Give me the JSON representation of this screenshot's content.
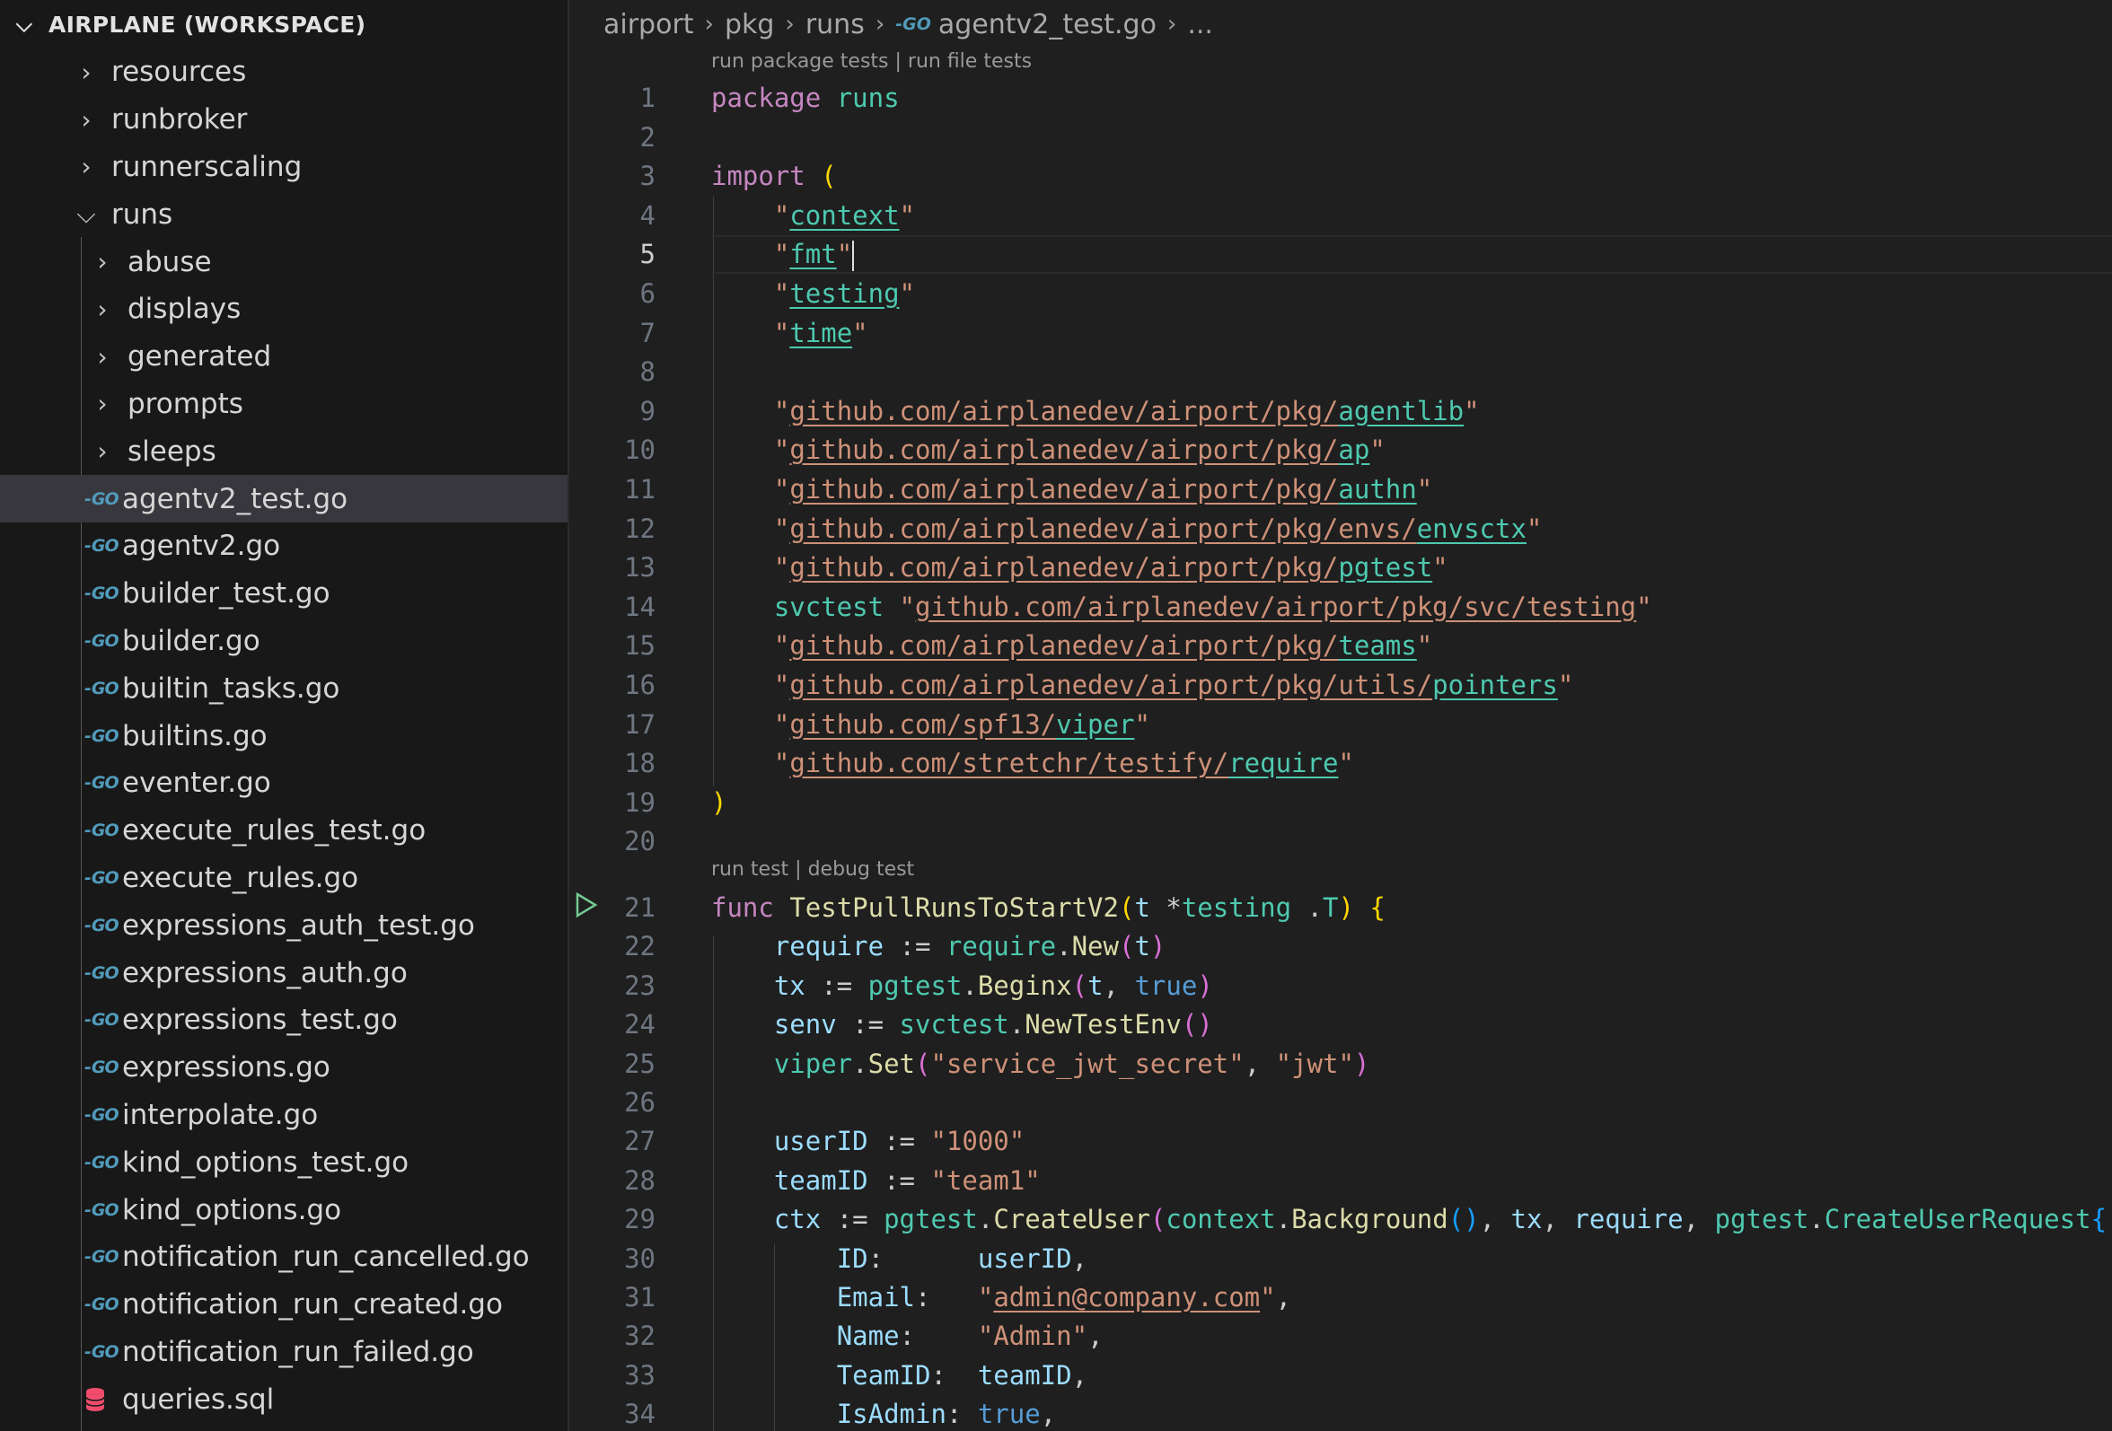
{
  "sidebar": {
    "workspace_title": "AIRPLANE (WORKSPACE)",
    "items": [
      {
        "label": "resources",
        "type": "folder",
        "expanded": false,
        "depth": 1
      },
      {
        "label": "runbroker",
        "type": "folder",
        "expanded": false,
        "depth": 1
      },
      {
        "label": "runnerscaling",
        "type": "folder",
        "expanded": false,
        "depth": 1
      },
      {
        "label": "runs",
        "type": "folder",
        "expanded": true,
        "depth": 1
      },
      {
        "label": "abuse",
        "type": "folder",
        "expanded": false,
        "depth": 2
      },
      {
        "label": "displays",
        "type": "folder",
        "expanded": false,
        "depth": 2
      },
      {
        "label": "generated",
        "type": "folder",
        "expanded": false,
        "depth": 2
      },
      {
        "label": "prompts",
        "type": "folder",
        "expanded": false,
        "depth": 2
      },
      {
        "label": "sleeps",
        "type": "folder",
        "expanded": false,
        "depth": 2
      },
      {
        "label": "agentv2_test.go",
        "type": "go",
        "selected": true,
        "depth": 2
      },
      {
        "label": "agentv2.go",
        "type": "go",
        "depth": 2
      },
      {
        "label": "builder_test.go",
        "type": "go",
        "depth": 2
      },
      {
        "label": "builder.go",
        "type": "go",
        "depth": 2
      },
      {
        "label": "builtin_tasks.go",
        "type": "go",
        "depth": 2
      },
      {
        "label": "builtins.go",
        "type": "go",
        "depth": 2
      },
      {
        "label": "eventer.go",
        "type": "go",
        "depth": 2
      },
      {
        "label": "execute_rules_test.go",
        "type": "go",
        "depth": 2
      },
      {
        "label": "execute_rules.go",
        "type": "go",
        "depth": 2
      },
      {
        "label": "expressions_auth_test.go",
        "type": "go",
        "depth": 2
      },
      {
        "label": "expressions_auth.go",
        "type": "go",
        "depth": 2
      },
      {
        "label": "expressions_test.go",
        "type": "go",
        "depth": 2
      },
      {
        "label": "expressions.go",
        "type": "go",
        "depth": 2
      },
      {
        "label": "interpolate.go",
        "type": "go",
        "depth": 2
      },
      {
        "label": "kind_options_test.go",
        "type": "go",
        "depth": 2
      },
      {
        "label": "kind_options.go",
        "type": "go",
        "depth": 2
      },
      {
        "label": "notification_run_cancelled.go",
        "type": "go",
        "depth": 2
      },
      {
        "label": "notification_run_created.go",
        "type": "go",
        "depth": 2
      },
      {
        "label": "notification_run_failed.go",
        "type": "go",
        "depth": 2
      },
      {
        "label": "queries.sql",
        "type": "sql",
        "depth": 2
      }
    ]
  },
  "breadcrumb": {
    "parts": [
      "airport",
      "pkg",
      "runs",
      "agentv2_test.go",
      "..."
    ],
    "go_icon": "GO"
  },
  "editor": {
    "codelens_top": "run package tests | run file tests",
    "codelens_func": "run test | debug test",
    "current_line": 5,
    "line_numbers": [
      "1",
      "2",
      "3",
      "4",
      "5",
      "6",
      "7",
      "8",
      "9",
      "10",
      "11",
      "12",
      "13",
      "14",
      "15",
      "16",
      "17",
      "18",
      "19",
      "20",
      "21",
      "22",
      "23",
      "24",
      "25",
      "26",
      "27",
      "28",
      "29",
      "30",
      "31",
      "32",
      "33",
      "34"
    ],
    "colors": {
      "keyword": "#c586c0",
      "type": "#4ec9b0",
      "function": "#dcdcaa",
      "variable": "#9cdcfe",
      "string": "#ce9178",
      "constant": "#569cd6"
    },
    "lines": [
      [
        [
          "k",
          "package"
        ],
        [
          "",
          "",
          " "
        ],
        [
          "t",
          "runs"
        ]
      ],
      [],
      [
        [
          "k",
          "import"
        ],
        [
          "",
          "",
          " "
        ],
        [
          "p1",
          "("
        ]
      ],
      [
        [
          "",
          "",
          " "
        ],
        [
          "s",
          "\""
        ],
        [
          "t u",
          "context"
        ],
        [
          "s",
          "\""
        ]
      ],
      [
        [
          "",
          "",
          " "
        ],
        [
          "s",
          "\""
        ],
        [
          "t u",
          "fmt"
        ],
        [
          "s",
          "\""
        ]
      ],
      [
        [
          "",
          "",
          " "
        ],
        [
          "s",
          "\""
        ],
        [
          "t u",
          "testing"
        ],
        [
          "s",
          "\""
        ]
      ],
      [
        [
          "",
          "",
          " "
        ],
        [
          "s",
          "\""
        ],
        [
          "t u",
          "time"
        ],
        [
          "s",
          "\""
        ]
      ],
      [],
      [
        [
          "",
          "",
          " "
        ],
        [
          "s",
          "\""
        ],
        [
          "s u",
          "github.com/airplanedev/airport/pkg/"
        ],
        [
          "t u",
          "agentlib"
        ],
        [
          "s",
          "\""
        ]
      ],
      [
        [
          "",
          "",
          " "
        ],
        [
          "s",
          "\""
        ],
        [
          "s u",
          "github.com/airplanedev/airport/pkg/"
        ],
        [
          "t u",
          "ap"
        ],
        [
          "s",
          "\""
        ]
      ],
      [
        [
          "",
          "",
          " "
        ],
        [
          "s",
          "\""
        ],
        [
          "s u",
          "github.com/airplanedev/airport/pkg/"
        ],
        [
          "t u",
          "authn"
        ],
        [
          "s",
          "\""
        ]
      ],
      [
        [
          "",
          "",
          " "
        ],
        [
          "s",
          "\""
        ],
        [
          "s u",
          "github.com/airplanedev/airport/pkg/envs/"
        ],
        [
          "t u",
          "envsctx"
        ],
        [
          "s",
          "\""
        ]
      ],
      [
        [
          "",
          "",
          " "
        ],
        [
          "s",
          "\""
        ],
        [
          "s u",
          "github.com/airplanedev/airport/pkg/"
        ],
        [
          "t u",
          "pgtest"
        ],
        [
          "s",
          "\""
        ]
      ],
      [
        [
          "",
          "",
          " "
        ],
        [
          "t",
          "svctest"
        ],
        [
          "",
          "",
          " "
        ],
        [
          "s",
          "\""
        ],
        [
          "s u",
          "github.com/airplanedev/airport/pkg/svc/testing"
        ],
        [
          "s",
          "\""
        ]
      ],
      [
        [
          "",
          "",
          " "
        ],
        [
          "s",
          "\""
        ],
        [
          "s u",
          "github.com/airplanedev/airport/pkg/"
        ],
        [
          "t u",
          "teams"
        ],
        [
          "s",
          "\""
        ]
      ],
      [
        [
          "",
          "",
          " "
        ],
        [
          "s",
          "\""
        ],
        [
          "s u",
          "github.com/airplanedev/airport/pkg/utils/"
        ],
        [
          "t u",
          "pointers"
        ],
        [
          "s",
          "\""
        ]
      ],
      [
        [
          "",
          "",
          " "
        ],
        [
          "s",
          "\""
        ],
        [
          "s u",
          "github.com/spf13/"
        ],
        [
          "t u",
          "viper"
        ],
        [
          "s",
          "\""
        ]
      ],
      [
        [
          "",
          "",
          " "
        ],
        [
          "s",
          "\""
        ],
        [
          "s u",
          "github.com/stretchr/testify/"
        ],
        [
          "t u",
          "require"
        ],
        [
          "s",
          "\""
        ]
      ],
      [
        [
          "p1",
          ")"
        ]
      ],
      [],
      [
        [
          "k",
          "func"
        ],
        [
          "",
          "",
          " "
        ],
        [
          "f",
          "TestPullRunsToStartV2"
        ],
        [
          "p1",
          "("
        ],
        [
          "v",
          "t"
        ],
        [
          "",
          "",
          " *"
        ],
        [
          "t",
          "testing"
        ],
        [
          "",
          "",
          " ."
        ],
        [
          "t",
          "T"
        ],
        [
          "p1",
          ")"
        ],
        [
          "",
          "",
          " "
        ],
        [
          "p1",
          "{"
        ]
      ],
      [
        [
          "",
          "",
          " "
        ],
        [
          "v",
          "require"
        ],
        [
          "",
          "",
          " := "
        ],
        [
          "t",
          "require"
        ],
        [
          "",
          "",
          "."
        ],
        [
          "f",
          "New"
        ],
        [
          "p2",
          "("
        ],
        [
          "v",
          "t"
        ],
        [
          "p2",
          ")"
        ]
      ],
      [
        [
          "",
          "",
          " "
        ],
        [
          "v",
          "tx"
        ],
        [
          "",
          "",
          " := "
        ],
        [
          "t",
          "pgtest"
        ],
        [
          "",
          "",
          "."
        ],
        [
          "f",
          "Beginx"
        ],
        [
          "p2",
          "("
        ],
        [
          "v",
          "t"
        ],
        [
          "",
          "",
          ", "
        ],
        [
          "kb",
          "true"
        ],
        [
          "p2",
          ")"
        ]
      ],
      [
        [
          "",
          "",
          " "
        ],
        [
          "v",
          "senv"
        ],
        [
          "",
          "",
          " := "
        ],
        [
          "t",
          "svctest"
        ],
        [
          "",
          "",
          "."
        ],
        [
          "f",
          "NewTestEnv"
        ],
        [
          "p2",
          "()"
        ]
      ],
      [
        [
          "",
          "",
          " "
        ],
        [
          "t",
          "viper"
        ],
        [
          "",
          "",
          "."
        ],
        [
          "f",
          "Set"
        ],
        [
          "p2",
          "("
        ],
        [
          "s",
          "\"service_jwt_secret\""
        ],
        [
          "",
          "",
          ", "
        ],
        [
          "s",
          "\"jwt\""
        ],
        [
          "p2",
          ")"
        ]
      ],
      [],
      [
        [
          "",
          "",
          " "
        ],
        [
          "v",
          "userID"
        ],
        [
          "",
          "",
          " := "
        ],
        [
          "s",
          "\"1000\""
        ]
      ],
      [
        [
          "",
          "",
          " "
        ],
        [
          "v",
          "teamID"
        ],
        [
          "",
          "",
          " := "
        ],
        [
          "s",
          "\"team1\""
        ]
      ],
      [
        [
          "",
          "",
          " "
        ],
        [
          "v",
          "ctx"
        ],
        [
          "",
          "",
          " := "
        ],
        [
          "t",
          "pgtest"
        ],
        [
          "",
          "",
          "."
        ],
        [
          "f",
          "CreateUser"
        ],
        [
          "p2",
          "("
        ],
        [
          "t",
          "context"
        ],
        [
          "",
          "",
          "."
        ],
        [
          "f",
          "Background"
        ],
        [
          "p3",
          "()"
        ],
        [
          "",
          "",
          ", "
        ],
        [
          "v",
          "tx"
        ],
        [
          "",
          "",
          ", "
        ],
        [
          "v",
          "require"
        ],
        [
          "",
          "",
          ", "
        ],
        [
          "t",
          "pgtest"
        ],
        [
          "",
          "",
          "."
        ],
        [
          "t",
          "CreateUserRequest"
        ],
        [
          "p3",
          "{"
        ]
      ],
      [
        [
          "",
          "",
          " "
        ],
        [
          "v",
          "ID"
        ],
        [
          "",
          "",
          ":      "
        ],
        [
          "v",
          "userID"
        ],
        [
          "",
          "",
          ","
        ]
      ],
      [
        [
          "",
          "",
          " "
        ],
        [
          "v",
          "Email"
        ],
        [
          "",
          "",
          ":   "
        ],
        [
          "s",
          "\""
        ],
        [
          "s u",
          "admin@company.com"
        ],
        [
          "s",
          "\""
        ],
        [
          "",
          "",
          ","
        ]
      ],
      [
        [
          "",
          "",
          " "
        ],
        [
          "v",
          "Name"
        ],
        [
          "",
          "",
          ":    "
        ],
        [
          "s",
          "\"Admin\""
        ],
        [
          "",
          "",
          ","
        ]
      ],
      [
        [
          "",
          "",
          " "
        ],
        [
          "v",
          "TeamID"
        ],
        [
          "",
          "",
          ":  "
        ],
        [
          "v",
          "teamID"
        ],
        [
          "",
          "",
          ","
        ]
      ],
      [
        [
          "",
          "",
          " "
        ],
        [
          "v",
          "IsAdmin"
        ],
        [
          "",
          "",
          ": "
        ],
        [
          "kb",
          "true"
        ],
        [
          "",
          "",
          ","
        ]
      ]
    ]
  }
}
